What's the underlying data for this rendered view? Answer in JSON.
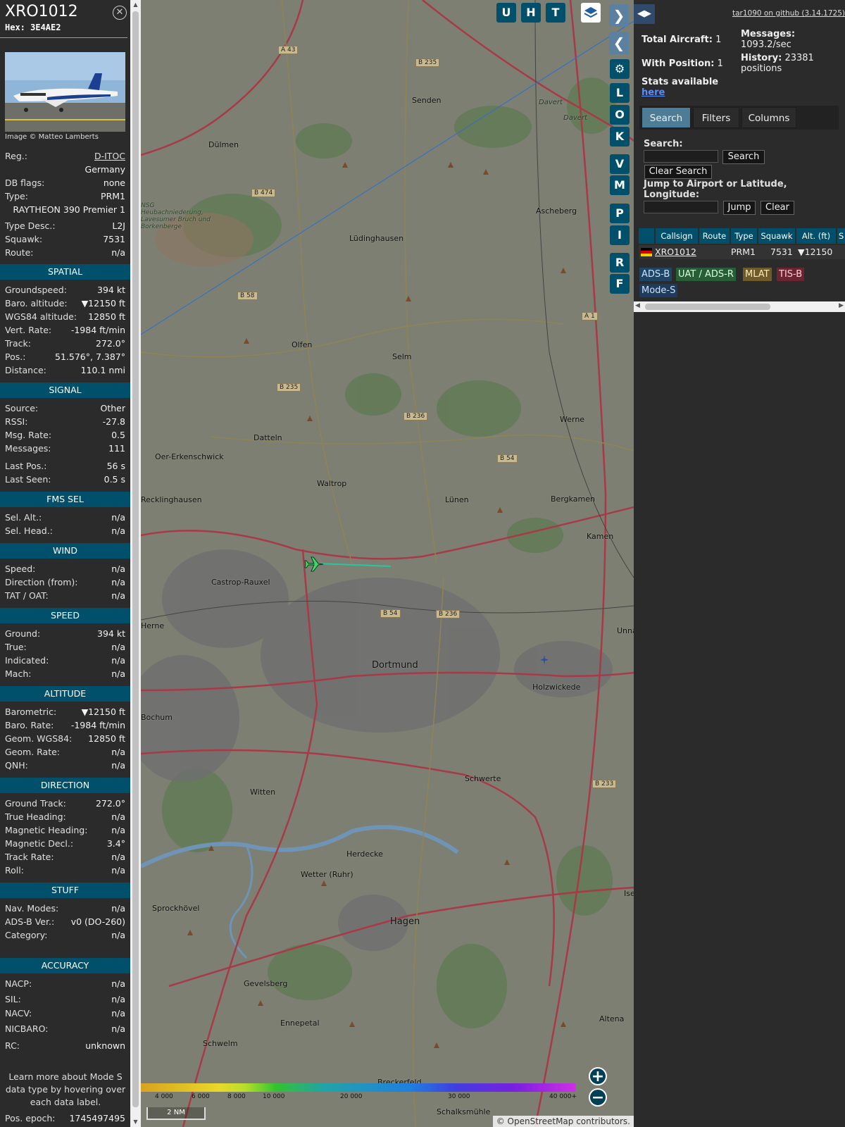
{
  "infoblock": {
    "callsign": "XRO1012",
    "hex": "Hex:  3E4AE2",
    "photo_credit": "Image © Matteo Lamberts",
    "rows_top": [
      {
        "label": "Reg.:",
        "value": "D-ITOC"
      },
      {
        "label": "",
        "value": "Germany"
      },
      {
        "label": "DB flags:",
        "value": "none"
      },
      {
        "label": "Type:",
        "value": "PRM1"
      },
      {
        "label": "",
        "value": "RAYTHEON 390 Premier 1"
      },
      {
        "label": "Type Desc.:",
        "value": "L2J"
      },
      {
        "label": "Squawk:",
        "value": "7531"
      },
      {
        "label": "Route:",
        "value": "n/a"
      }
    ],
    "sections": {
      "spatial": "SPATIAL",
      "signal": "SIGNAL",
      "fms": "FMS SEL",
      "wind": "WIND",
      "speed": "SPEED",
      "altitude": "ALTITUDE",
      "direction": "DIRECTION",
      "stuff": "STUFF",
      "accuracy": "ACCURACY"
    },
    "spatial": [
      {
        "label": "Groundspeed:",
        "value": "394 kt"
      },
      {
        "label": "Baro. altitude:",
        "value": "▼12150 ft"
      },
      {
        "label": "WGS84 altitude:",
        "value": "12850 ft"
      },
      {
        "label": "Vert. Rate:",
        "value": "-1984 ft/min"
      },
      {
        "label": "Track:",
        "value": "272.0°"
      },
      {
        "label": "Pos.:",
        "value": "51.576°, 7.387°"
      },
      {
        "label": "Distance:",
        "value": "110.1 nmi"
      }
    ],
    "signal": [
      {
        "label": "Source:",
        "value": "Other"
      },
      {
        "label": "RSSI:",
        "value": "-27.8"
      },
      {
        "label": "Msg. Rate:",
        "value": "0.5"
      },
      {
        "label": "Messages:",
        "value": "111"
      },
      {
        "label": "Last Pos.:",
        "value": "56 s"
      },
      {
        "label": "Last Seen:",
        "value": "0.5 s"
      }
    ],
    "fms": [
      {
        "label": "Sel. Alt.:",
        "value": "n/a"
      },
      {
        "label": "Sel. Head.:",
        "value": "n/a"
      }
    ],
    "wind": [
      {
        "label": "Speed:",
        "value": "n/a"
      },
      {
        "label": "Direction (from):",
        "value": "n/a"
      },
      {
        "label": "TAT / OAT:",
        "value": "n/a"
      }
    ],
    "speed": [
      {
        "label": "Ground:",
        "value": "394 kt"
      },
      {
        "label": "True:",
        "value": "n/a"
      },
      {
        "label": "Indicated:",
        "value": "n/a"
      },
      {
        "label": "Mach:",
        "value": "n/a"
      }
    ],
    "altitude": [
      {
        "label": "Barometric:",
        "value": "▼12150 ft"
      },
      {
        "label": "Baro. Rate:",
        "value": "-1984 ft/min"
      },
      {
        "label": "Geom. WGS84:",
        "value": "12850 ft"
      },
      {
        "label": "Geom. Rate:",
        "value": "n/a"
      },
      {
        "label": "QNH:",
        "value": "n/a"
      }
    ],
    "direction": [
      {
        "label": "Ground Track:",
        "value": "272.0°"
      },
      {
        "label": "True Heading:",
        "value": "n/a"
      },
      {
        "label": "Magnetic Heading:",
        "value": "n/a"
      },
      {
        "label": "Magnetic Decl.:",
        "value": "3.4°"
      },
      {
        "label": "Track Rate:",
        "value": "n/a"
      },
      {
        "label": "Roll:",
        "value": "n/a"
      }
    ],
    "stuff": [
      {
        "label": "Nav. Modes:",
        "value": "n/a"
      },
      {
        "label": "ADS-B Ver.:",
        "value": "v0 (DO-260)"
      },
      {
        "label": "Category:",
        "value": "n/a"
      }
    ],
    "accuracy": [
      {
        "label": "NACP:",
        "value": "n/a"
      },
      {
        "label": "SIL:",
        "value": "n/a"
      },
      {
        "label": "NACV:",
        "value": "n/a"
      },
      {
        "label": "NICBARO:",
        "value": "n/a"
      },
      {
        "label": "RC:",
        "value": "unknown"
      }
    ],
    "learn_more": "Learn more about Mode S data type by hovering over each data label.",
    "pos_epoch_label": "Pos. epoch:",
    "pos_epoch_value": "1745497495"
  },
  "map": {
    "buttons": [
      "U",
      "H",
      "T",
      "L",
      "O",
      "K",
      "V",
      "M",
      "P",
      "I",
      "R",
      "F"
    ],
    "places": [
      "Senden",
      "Dülmen",
      "Lüdinghausen",
      "Ascheberg",
      "Olfen",
      "Selm",
      "Datteln",
      "Oer-Erkenschwick",
      "Waltrop",
      "Lünen",
      "Bergkamen",
      "Werne",
      "Kamen",
      "Castrop-Rauxel",
      "Dortmund",
      "Holzwickede",
      "Unna",
      "Witten",
      "Schwerte",
      "Herdecke",
      "Wetter (Ruhr)",
      "Sprockhövel",
      "Hagen",
      "Gevelsberg",
      "Ennepetal",
      "Schwelm",
      "Altena",
      "Iserlohn",
      "Breckerfeld",
      "Schalksmühle",
      "Bochum",
      "Herne",
      "Recklinghausen",
      "Dülmen Heubachniederung"
    ],
    "roads": [
      "A 43",
      "B 235",
      "B 474",
      "B 58",
      "B 235",
      "B 236",
      "B 54",
      "B 54",
      "B 236",
      "A 1",
      "B 233",
      "Davert",
      "Davert"
    ],
    "nature_label": "NSG Heubachniederung, Lavesumer Bruch und Borkenberge",
    "scale": "2 NM",
    "attribution": "© OpenStreetMap contributors.",
    "alt_labels": [
      "4 000",
      "6 000",
      "8 000",
      "10 000",
      "20 000",
      "30 000",
      "40 000+"
    ],
    "zoom_in": "+",
    "zoom_out": "−"
  },
  "sidebar": {
    "github": "tar1090 on github (3.14.1725)",
    "total_aircraft_label": "Total Aircraft:",
    "total_aircraft": "1",
    "with_position_label": "With Position:",
    "with_position": "1",
    "messages_label": "Messages:",
    "messages_rate": "1093.2/sec",
    "history_label": "History:",
    "history_value": "23381 positions",
    "stats_text": "Stats available",
    "stats_link": "here",
    "tabs": [
      "Search",
      "Filters",
      "Columns"
    ],
    "search_label": "Search:",
    "search_button": "Search",
    "clear_search_button": "Clear Search",
    "jump_label": "Jump to Airport or Latitude, Longitude:",
    "jump_button": "Jump",
    "clear_button": "Clear",
    "table_headers": [
      "Callsign",
      "Route",
      "Type",
      "Squawk",
      "Alt. (ft)",
      "S"
    ],
    "table_row": {
      "callsign": "XRO1012",
      "route": "",
      "type": "PRM1",
      "squawk": "7531",
      "alt": "▼12150"
    },
    "badges": [
      {
        "label": "ADS-B",
        "bg": "#1e4466",
        "fg": "#cfe3ff"
      },
      {
        "label": "UAT / ADS-R",
        "bg": "#285e37",
        "fg": "#d8ffd8"
      },
      {
        "label": "MLAT",
        "bg": "#6e5a2a",
        "fg": "#ffe9b0"
      },
      {
        "label": "TIS-B",
        "bg": "#6b2430",
        "fg": "#ffd0d8"
      },
      {
        "label": "Mode-S",
        "bg": "#1e3a5c",
        "fg": "#cfe3ff"
      }
    ]
  }
}
